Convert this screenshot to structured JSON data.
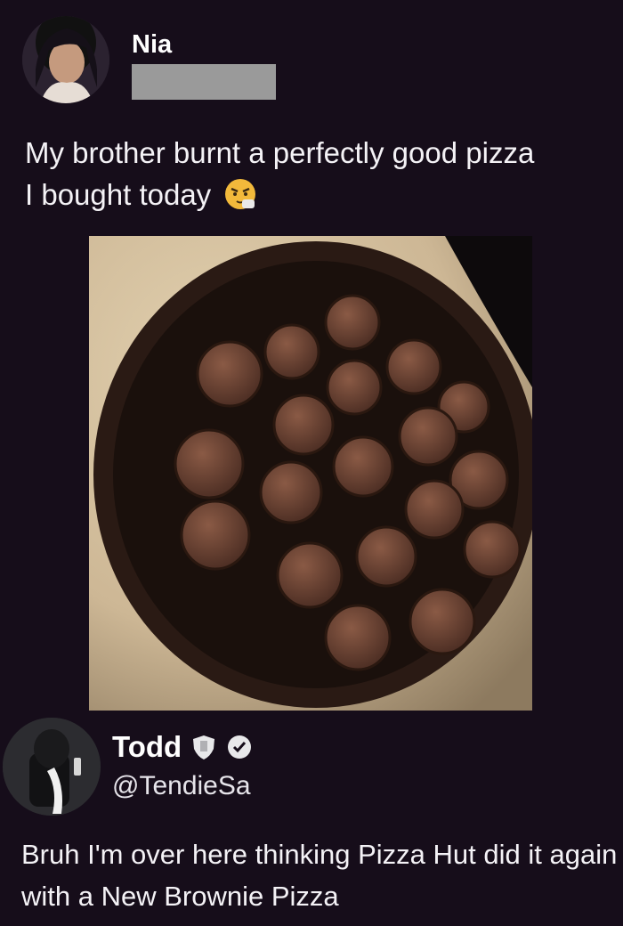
{
  "post": {
    "author_name": "Nia",
    "text_line1": "My brother burnt a perfectly good pizza",
    "text_line2": "I bought today",
    "emoji": "angry-face-emoji",
    "image_description_icon": "burnt-pizza-photo"
  },
  "reply": {
    "author_name": "Todd",
    "handle": "@TendieSa",
    "text": "Bruh I'm over here thinking Pizza Hut did it again with a New Brownie Pizza",
    "badges": [
      "shield-icon",
      "verified-icon"
    ]
  },
  "colors": {
    "background": "#160d1a",
    "redaction": "#9a9a9a",
    "text": "#f4f2f6"
  }
}
